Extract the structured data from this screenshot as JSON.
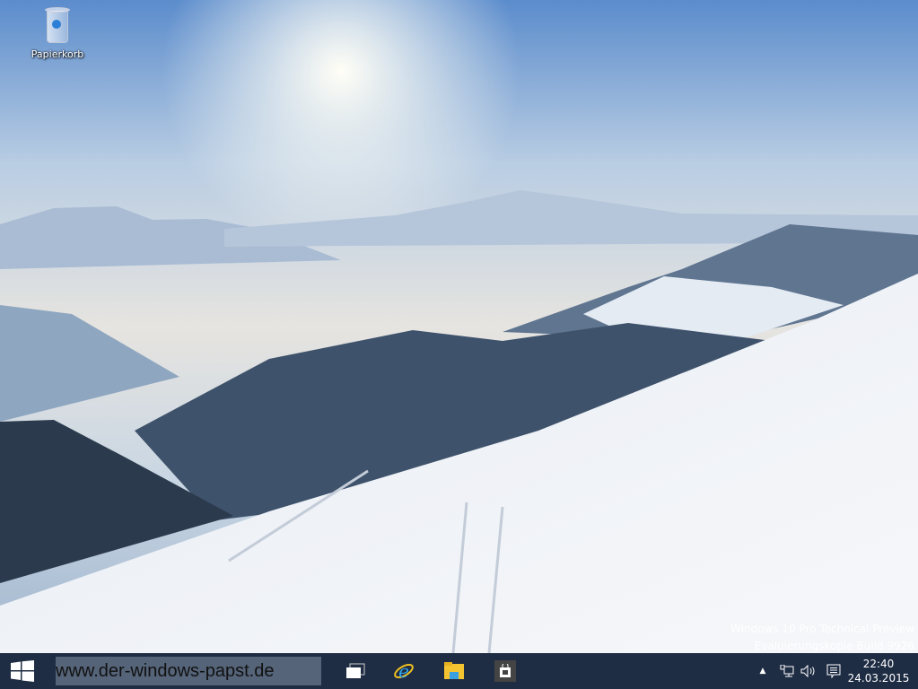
{
  "desktop": {
    "icons": [
      {
        "label": "Papierkorb",
        "icon": "recycle-bin-icon"
      }
    ]
  },
  "watermark": {
    "line1": "Windows 10 Pro Technical Preview",
    "line2": "Evaluierungskopie Build 9926"
  },
  "taskbar": {
    "start_icon": "windows-logo-icon",
    "search_overlay_text": "www.der-windows-papst.de",
    "apps": [
      {
        "name": "task-view",
        "icon": "task-view-icon"
      },
      {
        "name": "internet-explorer",
        "icon": "ie-icon"
      },
      {
        "name": "file-explorer",
        "icon": "folder-icon"
      },
      {
        "name": "store",
        "icon": "store-icon"
      }
    ],
    "tray": {
      "chevron": "▲",
      "time": "22:40",
      "date": "24.03.2015"
    },
    "color": "#1f2d44"
  }
}
